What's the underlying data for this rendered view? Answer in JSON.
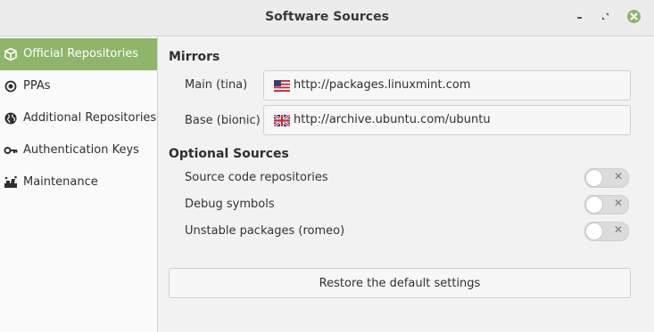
{
  "window": {
    "title": "Software Sources",
    "buttons": {
      "minimize_icon": "minimize-icon",
      "maximize_icon": "restore-icon",
      "close_icon": "close-icon"
    },
    "accent_color": "#8fb56a"
  },
  "sidebar": {
    "items": [
      {
        "label": "Official Repositories",
        "icon": "package-icon",
        "active": true
      },
      {
        "label": "PPAs",
        "icon": "ppa-icon",
        "active": false
      },
      {
        "label": "Additional Repositories",
        "icon": "globe-icon",
        "active": false
      },
      {
        "label": "Authentication Keys",
        "icon": "key-icon",
        "active": false
      },
      {
        "label": "Maintenance",
        "icon": "maintenance-icon",
        "active": false
      }
    ]
  },
  "mirrors": {
    "title": "Mirrors",
    "main": {
      "label": "Main (tina)",
      "url": "http://packages.linuxmint.com",
      "flag": "us-flag-icon"
    },
    "base": {
      "label": "Base (bionic)",
      "url": "http://archive.ubuntu.com/ubuntu",
      "flag": "uk-flag-icon"
    }
  },
  "optional": {
    "title": "Optional Sources",
    "items": [
      {
        "label": "Source code repositories",
        "enabled": false
      },
      {
        "label": "Debug symbols",
        "enabled": false
      },
      {
        "label": "Unstable packages (romeo)",
        "enabled": false
      }
    ],
    "switch_off_glyph": "✕"
  },
  "restore_label": "Restore the default settings"
}
